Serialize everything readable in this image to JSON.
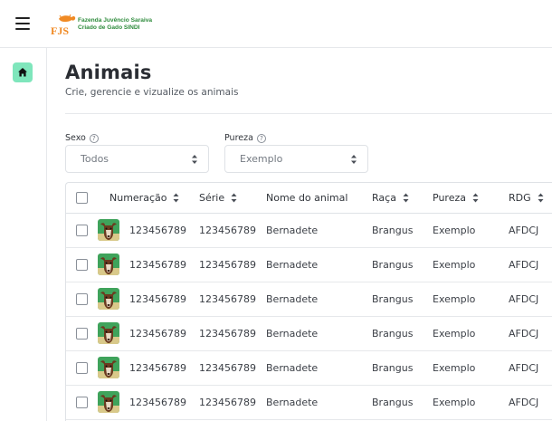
{
  "header": {
    "logo_initials": "FJS",
    "logo_line1": "Fazenda Juvêncio Saraiva",
    "logo_line2": "Criado de Gado SINDI"
  },
  "icons": {
    "menu": "hamburger-icon",
    "home": "home-icon",
    "help": "question-circle-icon",
    "sort": "sort-arrows-icon",
    "avatar": "cow-avatar"
  },
  "colors": {
    "accent": "#7fe6bc",
    "brand_orange": "#f08a24",
    "brand_green": "#2e8b3c"
  },
  "page": {
    "title": "Animais",
    "subtitle": "Crie, gerencie e vizualize os animais"
  },
  "filters": {
    "sexo": {
      "label": "Sexo",
      "value": "Todos"
    },
    "pureza": {
      "label": "Pureza",
      "value": "Exemplo"
    }
  },
  "table": {
    "columns": [
      "Numeração",
      "Série",
      "Nome do animal",
      "Raça",
      "Pureza",
      "RDG"
    ],
    "rows": [
      {
        "numeracao": "123456789",
        "serie": "123456789",
        "nome": "Bernadete",
        "raca": "Brangus",
        "pureza": "Exemplo",
        "rdg": "AFDCJ"
      },
      {
        "numeracao": "123456789",
        "serie": "123456789",
        "nome": "Bernadete",
        "raca": "Brangus",
        "pureza": "Exemplo",
        "rdg": "AFDCJ"
      },
      {
        "numeracao": "123456789",
        "serie": "123456789",
        "nome": "Bernadete",
        "raca": "Brangus",
        "pureza": "Exemplo",
        "rdg": "AFDCJ"
      },
      {
        "numeracao": "123456789",
        "serie": "123456789",
        "nome": "Bernadete",
        "raca": "Brangus",
        "pureza": "Exemplo",
        "rdg": "AFDCJ"
      },
      {
        "numeracao": "123456789",
        "serie": "123456789",
        "nome": "Bernadete",
        "raca": "Brangus",
        "pureza": "Exemplo",
        "rdg": "AFDCJ"
      },
      {
        "numeracao": "123456789",
        "serie": "123456789",
        "nome": "Bernadete",
        "raca": "Brangus",
        "pureza": "Exemplo",
        "rdg": "AFDCJ"
      }
    ]
  }
}
